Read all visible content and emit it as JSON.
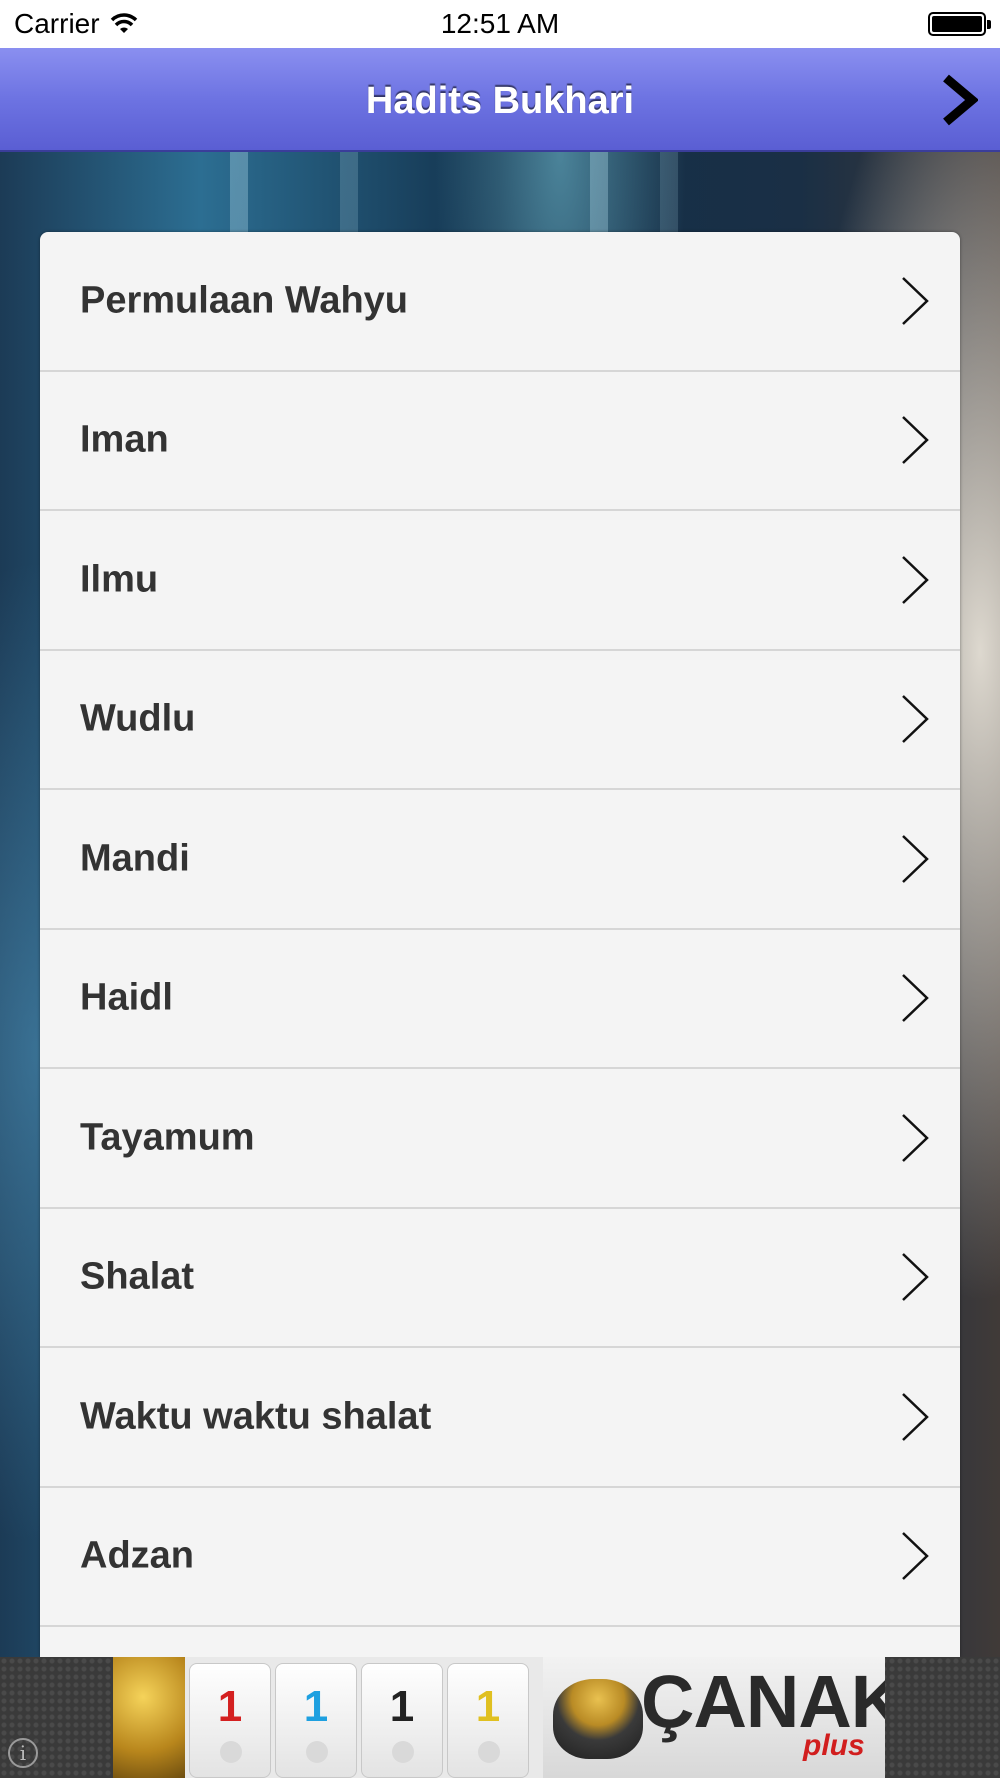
{
  "status_bar": {
    "carrier": "Carrier",
    "time": "12:51 AM",
    "icons": [
      "wifi-icon",
      "battery-icon"
    ]
  },
  "nav_bar": {
    "title": "Hadits Bukhari",
    "forward_icon": "chevron-right-icon"
  },
  "list": {
    "items": [
      {
        "label": "Permulaan Wahyu"
      },
      {
        "label": "Iman"
      },
      {
        "label": "Ilmu"
      },
      {
        "label": "Wudlu"
      },
      {
        "label": "Mandi"
      },
      {
        "label": "Haidl"
      },
      {
        "label": "Tayamum"
      },
      {
        "label": "Shalat"
      },
      {
        "label": "Waktu waktu shalat"
      },
      {
        "label": "Adzan"
      }
    ]
  },
  "ad": {
    "info_icon": "i",
    "tiles": [
      {
        "number": "1",
        "color": "#d42020"
      },
      {
        "number": "1",
        "color": "#1ea0e0"
      },
      {
        "number": "1",
        "color": "#222222"
      },
      {
        "number": "1",
        "color": "#e0c020"
      }
    ],
    "brand": "ÇANAK",
    "brand_sub": "plus"
  },
  "colors": {
    "nav_top": "#8a8ff0",
    "nav_bottom": "#5a5ed3",
    "list_background": "#f4f4f4",
    "list_text": "#333333"
  }
}
